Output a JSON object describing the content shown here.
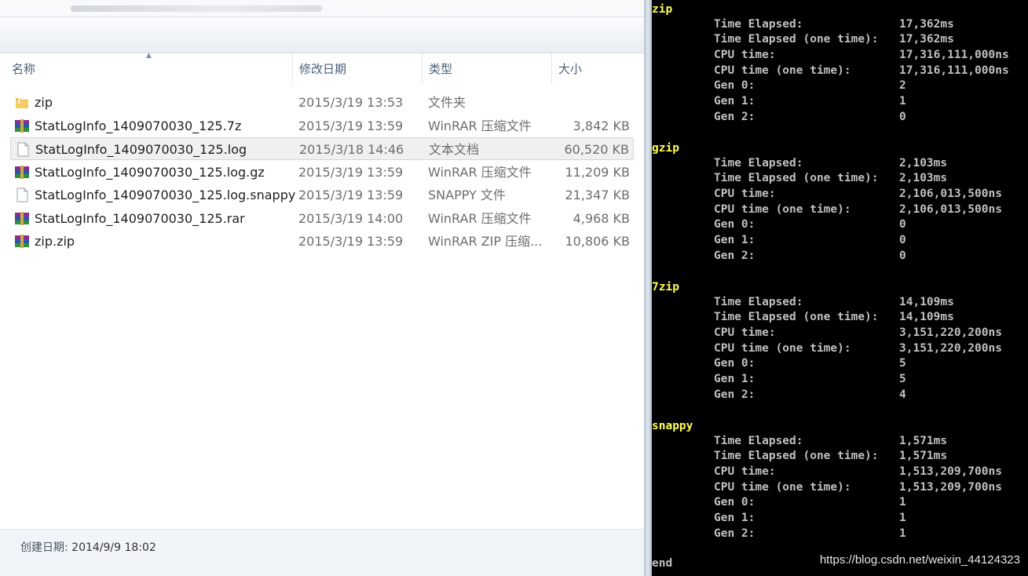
{
  "explorer": {
    "columns": {
      "name": "名称",
      "date": "修改日期",
      "type": "类型",
      "size": "大小"
    },
    "files": [
      {
        "icon": "folder-icon",
        "name": "zip",
        "date": "2015/3/19 13:53",
        "type": "文件夹",
        "size": ""
      },
      {
        "icon": "winrar-icon",
        "name": "StatLogInfo_1409070030_125.7z",
        "date": "2015/3/19 13:59",
        "type": "WinRAR 压缩文件",
        "size": "3,842 KB"
      },
      {
        "icon": "document-icon",
        "name": "StatLogInfo_1409070030_125.log",
        "date": "2015/3/18 14:46",
        "type": "文本文档",
        "size": "60,520 KB",
        "selected": true
      },
      {
        "icon": "winrar-icon",
        "name": "StatLogInfo_1409070030_125.log.gz",
        "date": "2015/3/19 13:59",
        "type": "WinRAR 压缩文件",
        "size": "11,209 KB"
      },
      {
        "icon": "document-icon",
        "name": "StatLogInfo_1409070030_125.log.snappy",
        "date": "2015/3/19 13:59",
        "type": "SNAPPY 文件",
        "size": "21,347 KB"
      },
      {
        "icon": "winrar-icon",
        "name": "StatLogInfo_1409070030_125.rar",
        "date": "2015/3/19 14:00",
        "type": "WinRAR 压缩文件",
        "size": "4,968 KB"
      },
      {
        "icon": "winrar-icon",
        "name": "zip.zip",
        "date": "2015/3/19 13:59",
        "type": "WinRAR ZIP 压缩...",
        "size": "10,806 KB"
      }
    ],
    "details": {
      "created_label": "创建日期:",
      "created_value": "2014/9/9 18:02"
    }
  },
  "console": {
    "sections": [
      {
        "title": "zip",
        "lines": [
          {
            "label": "Time Elapsed:",
            "value": "17,362ms"
          },
          {
            "label": "Time Elapsed (one time):",
            "value": "17,362ms"
          },
          {
            "label": "CPU time:",
            "value": "17,316,111,000ns"
          },
          {
            "label": "CPU time (one time):",
            "value": "17,316,111,000ns"
          },
          {
            "label": "Gen 0:",
            "value": "2"
          },
          {
            "label": "Gen 1:",
            "value": "1"
          },
          {
            "label": "Gen 2:",
            "value": "0"
          }
        ]
      },
      {
        "title": "gzip",
        "lines": [
          {
            "label": "Time Elapsed:",
            "value": "2,103ms"
          },
          {
            "label": "Time Elapsed (one time):",
            "value": "2,103ms"
          },
          {
            "label": "CPU time:",
            "value": "2,106,013,500ns"
          },
          {
            "label": "CPU time (one time):",
            "value": "2,106,013,500ns"
          },
          {
            "label": "Gen 0:",
            "value": "0"
          },
          {
            "label": "Gen 1:",
            "value": "0"
          },
          {
            "label": "Gen 2:",
            "value": "0"
          }
        ]
      },
      {
        "title": "7zip",
        "lines": [
          {
            "label": "Time Elapsed:",
            "value": "14,109ms"
          },
          {
            "label": "Time Elapsed (one time):",
            "value": "14,109ms"
          },
          {
            "label": "CPU time:",
            "value": "3,151,220,200ns"
          },
          {
            "label": "CPU time (one time):",
            "value": "3,151,220,200ns"
          },
          {
            "label": "Gen 0:",
            "value": "5"
          },
          {
            "label": "Gen 1:",
            "value": "5"
          },
          {
            "label": "Gen 2:",
            "value": "4"
          }
        ]
      },
      {
        "title": "snappy",
        "lines": [
          {
            "label": "Time Elapsed:",
            "value": "1,571ms"
          },
          {
            "label": "Time Elapsed (one time):",
            "value": "1,571ms"
          },
          {
            "label": "CPU time:",
            "value": "1,513,209,700ns"
          },
          {
            "label": "CPU time (one time):",
            "value": "1,513,209,700ns"
          },
          {
            "label": "Gen 0:",
            "value": "1"
          },
          {
            "label": "Gen 1:",
            "value": "1"
          },
          {
            "label": "Gen 2:",
            "value": "1"
          }
        ]
      }
    ],
    "end_text": "end"
  },
  "watermark": "https://blog.csdn.net/weixin_44124323",
  "colors": {
    "console_bg": "#000000",
    "console_text": "#c0c0c0",
    "console_heading": "#ffff55",
    "selected_row": "#f0f0f0"
  }
}
